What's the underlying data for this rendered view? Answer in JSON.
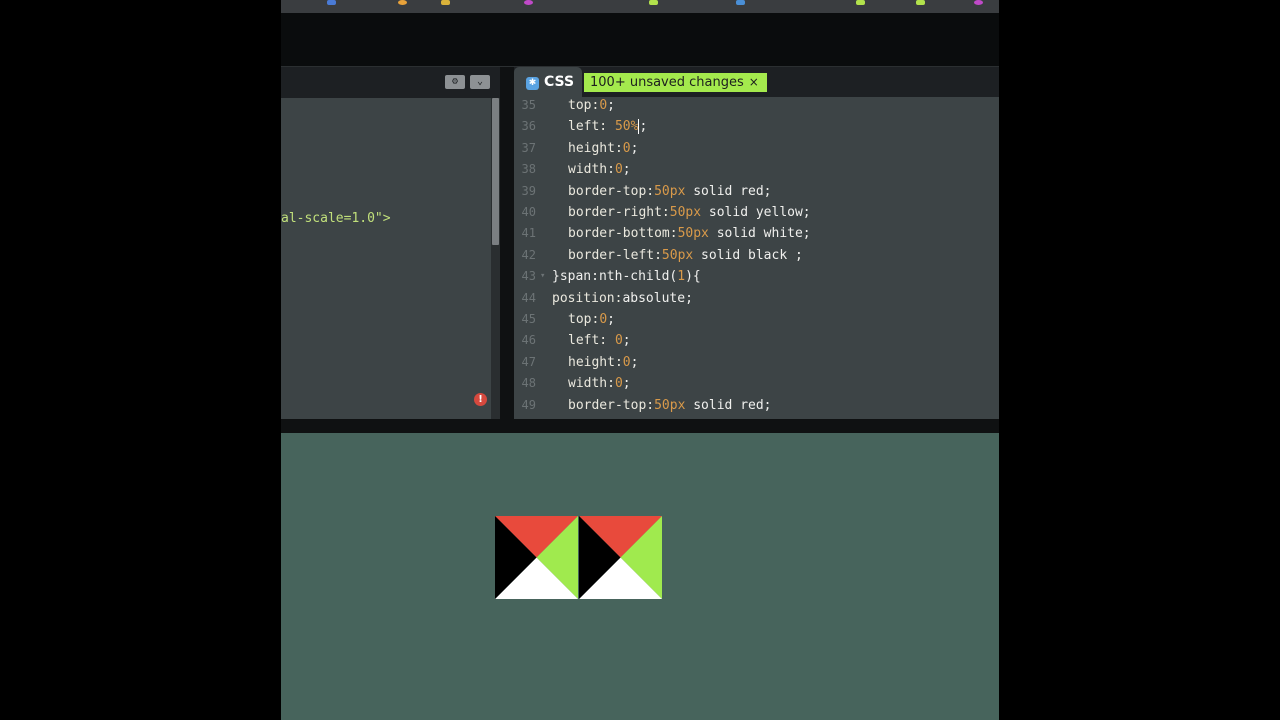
{
  "css_tab": {
    "label": "CSS",
    "icon": "css-file-icon",
    "badge": "100+ unsaved changes",
    "badge_close": "×"
  },
  "html_pane": {
    "visible_code": "al-scale=1.0\">"
  },
  "code_lines": [
    {
      "num": "35",
      "indent": 1,
      "parts": [
        [
          "prop",
          "top:"
        ],
        [
          "num",
          "0"
        ],
        [
          "kw",
          ";"
        ]
      ]
    },
    {
      "num": "36",
      "indent": 1,
      "cursor": true,
      "parts": [
        [
          "prop",
          "left: "
        ],
        [
          "num",
          "50%"
        ],
        [
          "kw",
          ";"
        ]
      ]
    },
    {
      "num": "37",
      "indent": 1,
      "parts": [
        [
          "prop",
          "height:"
        ],
        [
          "num",
          "0"
        ],
        [
          "kw",
          ";"
        ]
      ]
    },
    {
      "num": "38",
      "indent": 1,
      "parts": [
        [
          "prop",
          "width:"
        ],
        [
          "num",
          "0"
        ],
        [
          "kw",
          ";"
        ]
      ]
    },
    {
      "num": "39",
      "indent": 1,
      "parts": [
        [
          "prop",
          "border-top:"
        ],
        [
          "num",
          "50px"
        ],
        [
          "kw",
          " solid red;"
        ]
      ]
    },
    {
      "num": "40",
      "indent": 1,
      "parts": [
        [
          "prop",
          "border-right:"
        ],
        [
          "num",
          "50px"
        ],
        [
          "kw",
          " solid yellow;"
        ]
      ]
    },
    {
      "num": "41",
      "indent": 1,
      "parts": [
        [
          "prop",
          "border-bottom:"
        ],
        [
          "num",
          "50px"
        ],
        [
          "kw",
          " solid white;"
        ]
      ]
    },
    {
      "num": "42",
      "indent": 1,
      "parts": [
        [
          "prop",
          "border-left:"
        ],
        [
          "num",
          "50px"
        ],
        [
          "kw",
          " solid black ;"
        ]
      ]
    },
    {
      "num": "43",
      "indent": 0,
      "fold": true,
      "parts": [
        [
          "kw",
          "}span:nth-child("
        ],
        [
          "num",
          "1"
        ],
        [
          "kw",
          "){"
        ]
      ]
    },
    {
      "num": "44",
      "indent": 0,
      "parts": [
        [
          "prop",
          "position:"
        ],
        [
          "kw",
          "absolute;"
        ]
      ]
    },
    {
      "num": "45",
      "indent": 1,
      "parts": [
        [
          "prop",
          "top:"
        ],
        [
          "num",
          "0"
        ],
        [
          "kw",
          ";"
        ]
      ]
    },
    {
      "num": "46",
      "indent": 1,
      "parts": [
        [
          "prop",
          "left: "
        ],
        [
          "num",
          "0"
        ],
        [
          "kw",
          ";"
        ]
      ]
    },
    {
      "num": "47",
      "indent": 1,
      "parts": [
        [
          "prop",
          "height:"
        ],
        [
          "num",
          "0"
        ],
        [
          "kw",
          ";"
        ]
      ]
    },
    {
      "num": "48",
      "indent": 1,
      "parts": [
        [
          "prop",
          "width:"
        ],
        [
          "num",
          "0"
        ],
        [
          "kw",
          ";"
        ]
      ]
    },
    {
      "num": "49",
      "indent": 1,
      "parts": [
        [
          "prop",
          "border-top:"
        ],
        [
          "num",
          "50px"
        ],
        [
          "kw",
          " solid red;"
        ]
      ]
    }
  ],
  "preview": {
    "colors": {
      "top": "#e84a3c",
      "right": "#a0ea4e",
      "bottom": "#ffffff",
      "left": "#000000",
      "bg": "#47645c"
    },
    "shape_count": 2
  },
  "icons": {
    "settings": "gear-icon",
    "collapse": "chevron-down-icon",
    "error": "error-icon"
  }
}
